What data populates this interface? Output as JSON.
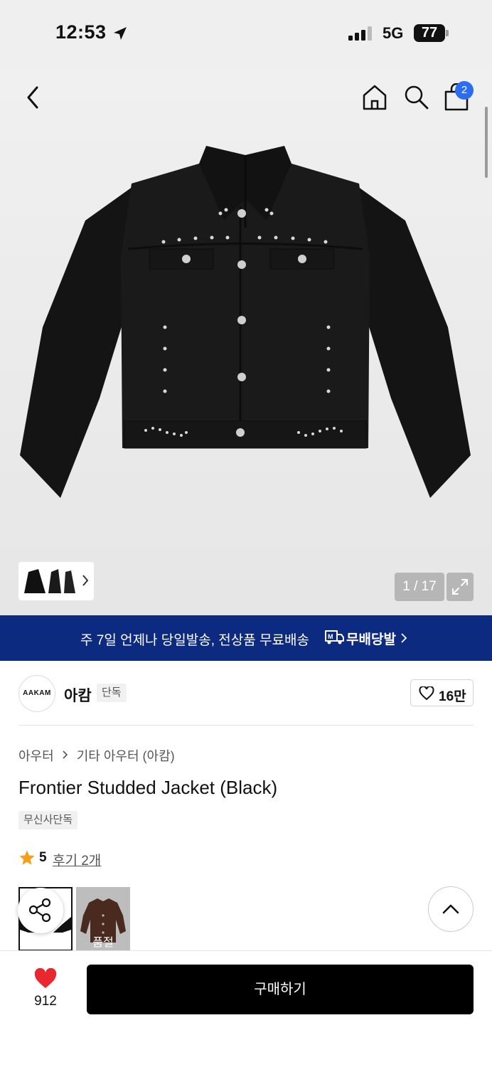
{
  "status_bar": {
    "time": "12:53",
    "network": "5G",
    "battery": "77"
  },
  "nav": {
    "cart_count": "2"
  },
  "gallery": {
    "counter": "1 / 17"
  },
  "promo_banner": {
    "text": "주 7일 언제나 당일발송, 전상품 무료배송",
    "brand": "무배당발"
  },
  "brand": {
    "logo_text": "AAKAM",
    "name": "아캄",
    "tag": "단독",
    "like_count": "16만"
  },
  "product": {
    "breadcrumb": [
      "아우터",
      "기타 아우터 (아캄)"
    ],
    "title": "Frontier Studded Jacket (Black)",
    "exclusive_tag": "무신사단독",
    "rating": "5",
    "review_link": "후기 2개",
    "colors": [
      {
        "name": "black",
        "status": ""
      },
      {
        "name": "brown",
        "status": "품절"
      }
    ]
  },
  "bottom_bar": {
    "wish_count": "912",
    "buy_label": "구매하기"
  },
  "colors": {
    "banner": "#0c2a7f",
    "cart_badge": "#2b6cf0",
    "star": "#f5a01a",
    "heart": "#e8272f"
  },
  "icons": [
    "location-arrow-icon",
    "signal-icon",
    "back-icon",
    "home-icon",
    "search-icon",
    "cart-icon",
    "expand-icon",
    "delivery-truck-icon",
    "heart-outline-icon",
    "star-icon",
    "share-icon",
    "chevron-up-icon",
    "heart-filled-icon"
  ]
}
